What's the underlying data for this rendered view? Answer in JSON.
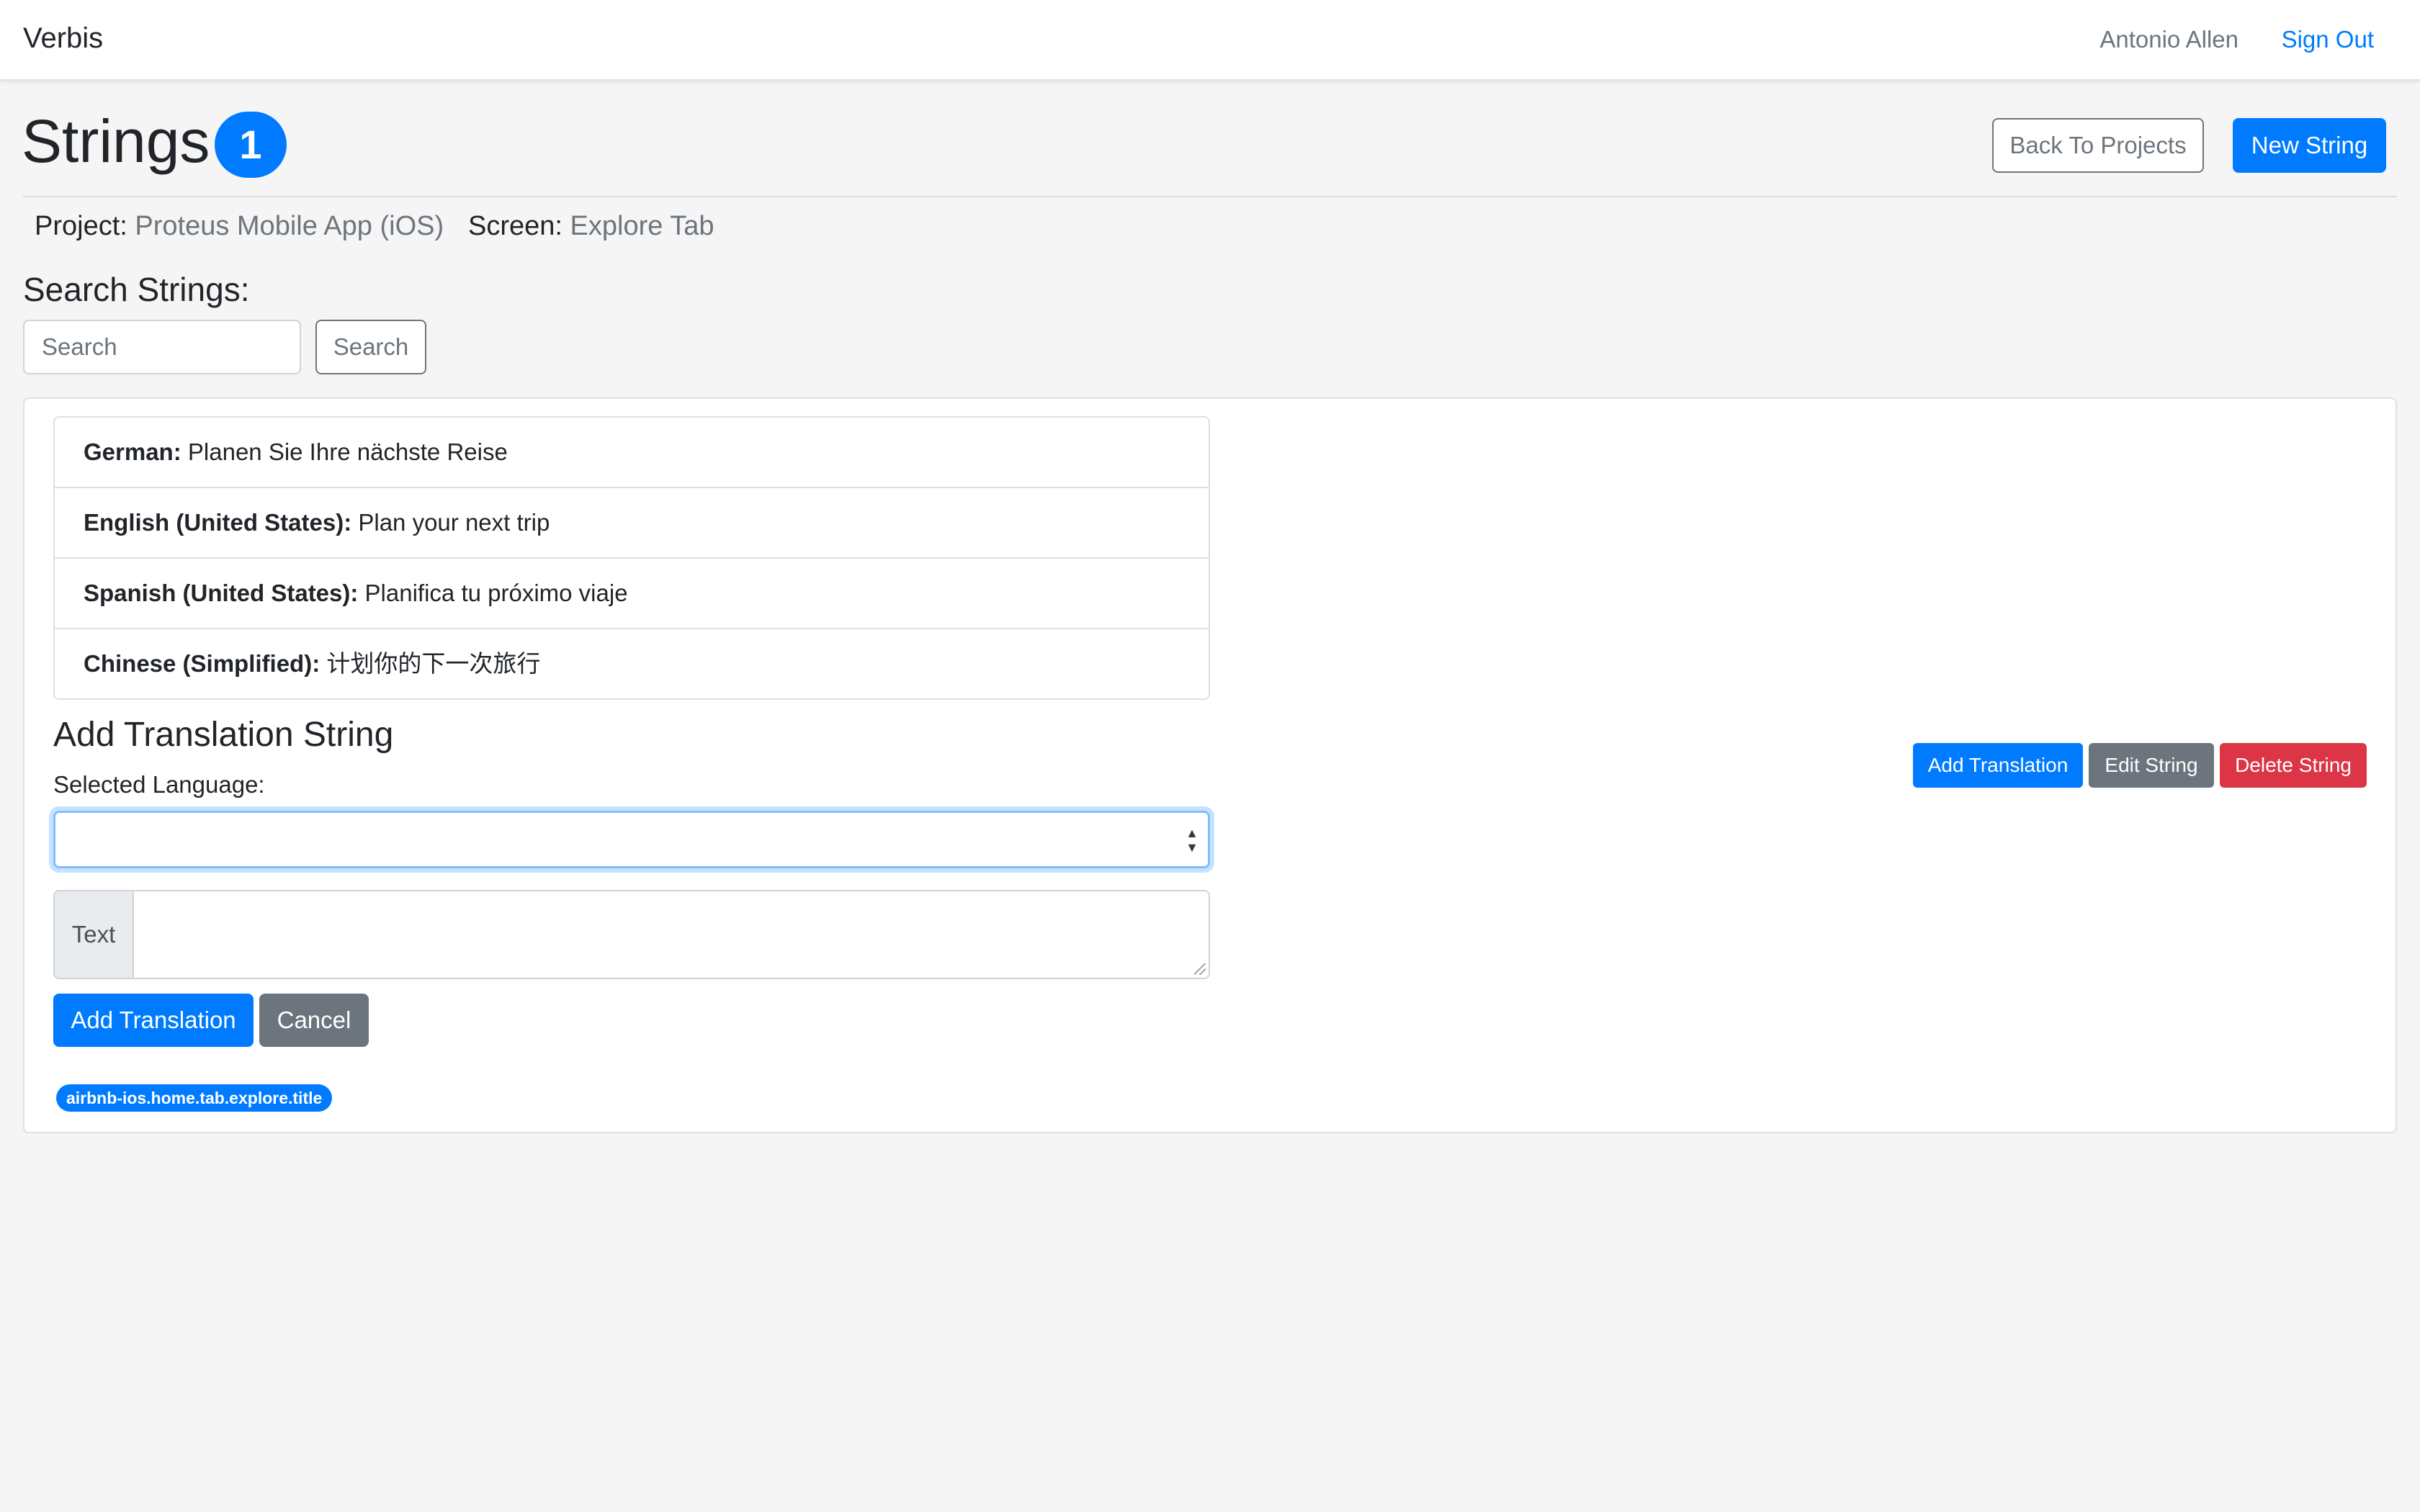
{
  "navbar": {
    "brand": "Verbis",
    "user_name": "Antonio Allen",
    "sign_out": "Sign Out"
  },
  "header": {
    "title": "Strings",
    "count": "1",
    "back_button": "Back To Projects",
    "new_button": "New String"
  },
  "meta": {
    "project_label": "Project:",
    "project_value": "Proteus Mobile App (iOS)",
    "screen_label": "Screen:",
    "screen_value": "Explore Tab"
  },
  "search": {
    "heading": "Search Strings:",
    "placeholder": "Search",
    "button": "Search"
  },
  "translations": [
    {
      "language": "German:",
      "text": "Planen Sie Ihre nächste Reise"
    },
    {
      "language": "English (United States):",
      "text": "Plan your next trip"
    },
    {
      "language": "Spanish (United States):",
      "text": "Planifica tu próximo viaje"
    },
    {
      "language": "Chinese (Simplified):",
      "text": "计划你的下一次旅行"
    }
  ],
  "add_form": {
    "heading": "Add Translation String",
    "language_label": "Selected Language:",
    "selected_language": "",
    "text_addon": "Text",
    "text_value": "",
    "submit": "Add Translation",
    "cancel": "Cancel"
  },
  "string_key": "airbnb-ios.home.tab.explore.title",
  "actions": {
    "add_translation": "Add Translation",
    "edit_string": "Edit String",
    "delete_string": "Delete String"
  },
  "colors": {
    "primary": "#007bff",
    "secondary": "#6c757d",
    "danger": "#dc3545",
    "background": "#f5f5f5"
  }
}
